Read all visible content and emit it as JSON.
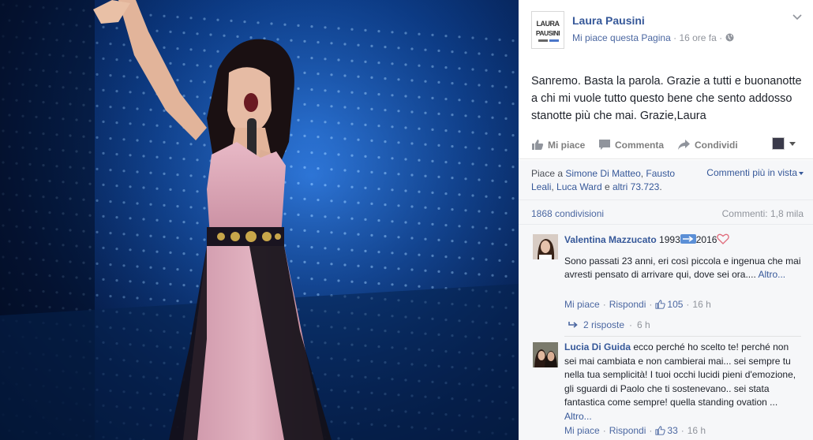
{
  "post": {
    "page_name": "Laura Pausini",
    "logo_text": [
      "LAURA",
      "PAUSINI"
    ],
    "like_page_label": "Mi piace questa Pagina",
    "timestamp": "16 ore fa",
    "privacy_icon": "globe-icon",
    "body": "Sanremo. Basta la parola. Grazie a tutti e buonanotte a chi mi vuole tutto questo bene che sento addosso stanotte più che mai. Grazie,Laura"
  },
  "actions": {
    "like": "Mi piace",
    "comment": "Commenta",
    "share": "Condividi"
  },
  "likes_summary": {
    "prefix": "Piace a",
    "names": [
      "Simone Di Matteo",
      "Fausto Leali",
      "Luca Ward"
    ],
    "others": "altri 73.723",
    "sort_label": "Commenti più in vista"
  },
  "counts": {
    "shares": "1868 condivisioni",
    "comments": "Commenti: 1,8 mila"
  },
  "comments": [
    {
      "author": "Valentina Mazzucato",
      "prefix": "1993",
      "suffix": "2016",
      "text": "Sono passati 23 anni, eri così piccola e ingenua che mai avresti pensato di arrivare qui, dove sei ora....",
      "more": "Altro...",
      "like": "Mi piace",
      "reply": "Rispondi",
      "likes": "105",
      "time": "16 h",
      "replies": "2 risposte",
      "replies_time": "6 h"
    },
    {
      "author": "Lucia Di Guida",
      "text": "ecco perché ho scelto te! perché non sei mai cambiata e non cambierai mai... sei sempre tu nella tua semplicità! I tuoi occhi lucidi pieni d'emozione, gli sguardi di Paolo che ti sostenevano.. sei stata fantastica come sempre! quella standing ovation ...",
      "more": "Altro...",
      "like": "Mi piace",
      "reply": "Rispondi",
      "likes": "33",
      "time": "16 h"
    }
  ],
  "colors": {
    "link": "#365899",
    "meta": "#90949c",
    "stage_blue": "#1d64c8",
    "dress_pink": "#d9a6b6"
  }
}
